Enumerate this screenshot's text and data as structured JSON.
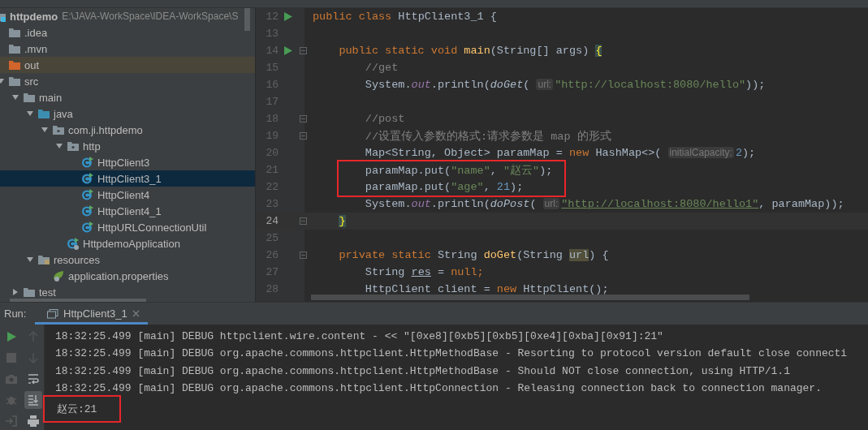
{
  "project_tree": [
    {
      "name": "httpdemo",
      "path": "E:\\JAVA-WorkSpace\\IDEA-WorkSpace\\S",
      "kind": "module",
      "selected": false,
      "highlighted": false,
      "children": [
        {
          "name": ".idea",
          "kind": "folder",
          "selected": false,
          "highlighted": false
        },
        {
          "name": ".mvn",
          "kind": "folder",
          "selected": false,
          "highlighted": false
        },
        {
          "name": "out",
          "kind": "excluded-folder",
          "selected": false,
          "highlighted": true
        },
        {
          "name": "src",
          "kind": "folder",
          "expanded": true,
          "selected": false,
          "highlighted": false,
          "children": [
            {
              "name": "main",
              "kind": "folder",
              "expanded": true,
              "selected": false,
              "highlighted": false,
              "children": [
                {
                  "name": "java",
                  "kind": "source-folder",
                  "expanded": true,
                  "selected": false,
                  "highlighted": false,
                  "children": [
                    {
                      "name": "com.ji.httpdemo",
                      "kind": "package",
                      "expanded": true,
                      "selected": false,
                      "highlighted": false,
                      "children": [
                        {
                          "name": "http",
                          "kind": "package",
                          "expanded": true,
                          "selected": false,
                          "highlighted": false,
                          "children": [
                            {
                              "name": "HttpClient3",
                              "kind": "class",
                              "selected": false,
                              "highlighted": false
                            },
                            {
                              "name": "HttpClient3_1",
                              "kind": "class",
                              "selected": true,
                              "highlighted": false
                            },
                            {
                              "name": "HttpClient4",
                              "kind": "class",
                              "selected": false,
                              "highlighted": false
                            },
                            {
                              "name": "HttpClient4_1",
                              "kind": "class",
                              "selected": false,
                              "highlighted": false
                            },
                            {
                              "name": "HttpURLConnectionUtil",
                              "kind": "class",
                              "selected": false,
                              "highlighted": false
                            }
                          ]
                        },
                        {
                          "name": "HttpdemoApplication",
                          "kind": "app-class",
                          "selected": false,
                          "highlighted": false
                        }
                      ]
                    }
                  ]
                },
                {
                  "name": "resources",
                  "kind": "resources-folder",
                  "expanded": true,
                  "selected": false,
                  "highlighted": false,
                  "children": [
                    {
                      "name": "application.properties",
                      "kind": "properties",
                      "selected": false,
                      "highlighted": false
                    }
                  ]
                }
              ]
            },
            {
              "name": "test",
              "kind": "folder",
              "expanded": false,
              "selected": false,
              "highlighted": false
            }
          ]
        }
      ]
    }
  ],
  "editor": {
    "lines": [
      {
        "number": "12",
        "run": true,
        "fold": false,
        "current": false,
        "boxed": false,
        "tokens": [
          {
            "kind": "keyword",
            "text": "public class "
          },
          {
            "kind": "plain",
            "text": "HttpClient3_1 {"
          }
        ]
      },
      {
        "number": "13",
        "run": false,
        "fold": false,
        "current": false,
        "boxed": false
      },
      {
        "number": "14",
        "run": true,
        "fold": true,
        "current": false,
        "boxed": false,
        "tokens": [
          {
            "kind": "keyword",
            "text": "    public static void "
          },
          {
            "kind": "method",
            "text": "main"
          },
          {
            "kind": "plain",
            "text": "(String[] args) "
          },
          {
            "kind": "brace",
            "text": "{"
          }
        ]
      },
      {
        "number": "15",
        "run": false,
        "fold": false,
        "current": false,
        "boxed": false,
        "tokens": [
          {
            "kind": "comment",
            "text": "        //get"
          }
        ]
      },
      {
        "number": "16",
        "run": false,
        "fold": false,
        "current": false,
        "boxed": false,
        "tokens": [
          {
            "kind": "plain",
            "text": "        System."
          },
          {
            "kind": "field",
            "text": "out"
          },
          {
            "kind": "plain",
            "text": ".println("
          },
          {
            "kind": "static-call",
            "text": "doGet"
          },
          {
            "kind": "plain",
            "text": "( "
          },
          {
            "kind": "hint",
            "text": "url:"
          },
          {
            "kind": "string",
            "text": "\"http://localhost:8080/hello\""
          },
          {
            "kind": "plain",
            "text": "));"
          }
        ]
      },
      {
        "number": "17",
        "run": false,
        "fold": false,
        "current": false,
        "boxed": false
      },
      {
        "number": "18",
        "run": false,
        "fold": true,
        "current": false,
        "boxed": false,
        "tokens": [
          {
            "kind": "comment",
            "text": "        //post"
          }
        ]
      },
      {
        "number": "19",
        "run": false,
        "fold": true,
        "current": false,
        "boxed": false,
        "tokens": [
          {
            "kind": "comment",
            "text": "        //设置传入参数的格式:请求参数是 map 的形式"
          }
        ]
      },
      {
        "number": "20",
        "run": false,
        "fold": false,
        "current": false,
        "boxed": false,
        "tokens": [
          {
            "kind": "plain",
            "text": "        Map<String, Object> paramMap = "
          },
          {
            "kind": "keyword",
            "text": "new "
          },
          {
            "kind": "plain",
            "text": "HashMap<>( "
          },
          {
            "kind": "hint",
            "text": "initialCapacity:"
          },
          {
            "kind": "number",
            "text": "2"
          },
          {
            "kind": "plain",
            "text": ");"
          }
        ]
      },
      {
        "number": "21",
        "run": false,
        "fold": false,
        "current": false,
        "boxed": true,
        "tokens": [
          {
            "kind": "plain",
            "text": "        paramMap.put("
          },
          {
            "kind": "string",
            "text": "\"name\""
          },
          {
            "kind": "plain",
            "text": ", "
          },
          {
            "kind": "string",
            "text": "\"赵云\""
          },
          {
            "kind": "plain",
            "text": ");"
          }
        ]
      },
      {
        "number": "22",
        "run": false,
        "fold": false,
        "current": false,
        "boxed": true,
        "tokens": [
          {
            "kind": "plain",
            "text": "        paramMap.put("
          },
          {
            "kind": "string",
            "text": "\"age\""
          },
          {
            "kind": "plain",
            "text": ", "
          },
          {
            "kind": "number",
            "text": "21"
          },
          {
            "kind": "plain",
            "text": ");"
          }
        ]
      },
      {
        "number": "23",
        "run": false,
        "fold": false,
        "current": false,
        "boxed": false,
        "tokens": [
          {
            "kind": "plain",
            "text": "        System."
          },
          {
            "kind": "field",
            "text": "out"
          },
          {
            "kind": "plain",
            "text": ".println("
          },
          {
            "kind": "static-call",
            "text": "doPost"
          },
          {
            "kind": "plain",
            "text": "( "
          },
          {
            "kind": "hint",
            "text": "url:"
          },
          {
            "kind": "link",
            "text": "\"http://localhost:8080/hello1\""
          },
          {
            "kind": "plain",
            "text": ", paramMap));"
          }
        ]
      },
      {
        "number": "24",
        "run": false,
        "fold": true,
        "current": true,
        "boxed": false,
        "tokens": [
          {
            "kind": "brace",
            "text": "    }"
          }
        ]
      },
      {
        "number": "25",
        "run": false,
        "fold": false,
        "current": false,
        "boxed": false
      },
      {
        "number": "26",
        "run": false,
        "fold": true,
        "current": false,
        "boxed": false,
        "tokens": [
          {
            "kind": "keyword",
            "text": "    private static "
          },
          {
            "kind": "plain",
            "text": "String "
          },
          {
            "kind": "method",
            "text": "doGet"
          },
          {
            "kind": "plain",
            "text": "(String "
          },
          {
            "kind": "param",
            "text": "url"
          },
          {
            "kind": "plain",
            "text": ") {"
          }
        ]
      },
      {
        "number": "27",
        "run": false,
        "fold": false,
        "current": false,
        "boxed": false,
        "tokens": [
          {
            "kind": "plain",
            "text": "        String "
          },
          {
            "kind": "unused",
            "text": "res"
          },
          {
            "kind": "plain",
            "text": " = "
          },
          {
            "kind": "keyword",
            "text": "null;"
          }
        ]
      },
      {
        "number": "28",
        "run": false,
        "fold": false,
        "current": false,
        "boxed": false,
        "tokens": [
          {
            "kind": "plain",
            "text": "        HttpClient client = "
          },
          {
            "kind": "keyword",
            "text": "new "
          },
          {
            "kind": "plain",
            "text": "HttpClient();"
          }
        ]
      }
    ]
  },
  "run_panel": {
    "label": "Run:",
    "tab": {
      "title": "HttpClient3_1",
      "selected": true
    },
    "toolbar_left": [
      {
        "kind": "run",
        "disabled": false
      },
      {
        "kind": "stop",
        "disabled": true
      },
      {
        "kind": "camera",
        "disabled": true
      },
      {
        "kind": "bug",
        "disabled": true
      },
      {
        "kind": "login",
        "disabled": true
      }
    ],
    "toolbar_right": [
      {
        "kind": "up",
        "disabled": true,
        "on": false
      },
      {
        "kind": "down",
        "disabled": true,
        "on": false
      },
      {
        "kind": "wrap",
        "disabled": false,
        "on": false
      },
      {
        "kind": "scroll-end",
        "disabled": false,
        "on": true
      },
      {
        "kind": "print",
        "disabled": false,
        "on": false
      }
    ],
    "console": [
      {
        "text": "18:32:25.499 [main] DEBUG httpclient.wire.content - << \"[0xe8][0xb5][0xb5][0xe4][0xba][0x91]:21\"",
        "boxed": false
      },
      {
        "text": "18:32:25.499 [main] DEBUG org.apache.commons.httpclient.HttpMethodBase - Resorting to protocol version default close connecti",
        "boxed": false
      },
      {
        "text": "18:32:25.499 [main] DEBUG org.apache.commons.httpclient.HttpMethodBase - Should NOT close connection, using HTTP/1.1",
        "boxed": false
      },
      {
        "text": "18:32:25.499 [main] DEBUG org.apache.commons.httpclient.HttpConnection - Releasing connection back to connection manager.",
        "boxed": false
      },
      {
        "text": "赵云:21",
        "boxed": true
      }
    ]
  }
}
